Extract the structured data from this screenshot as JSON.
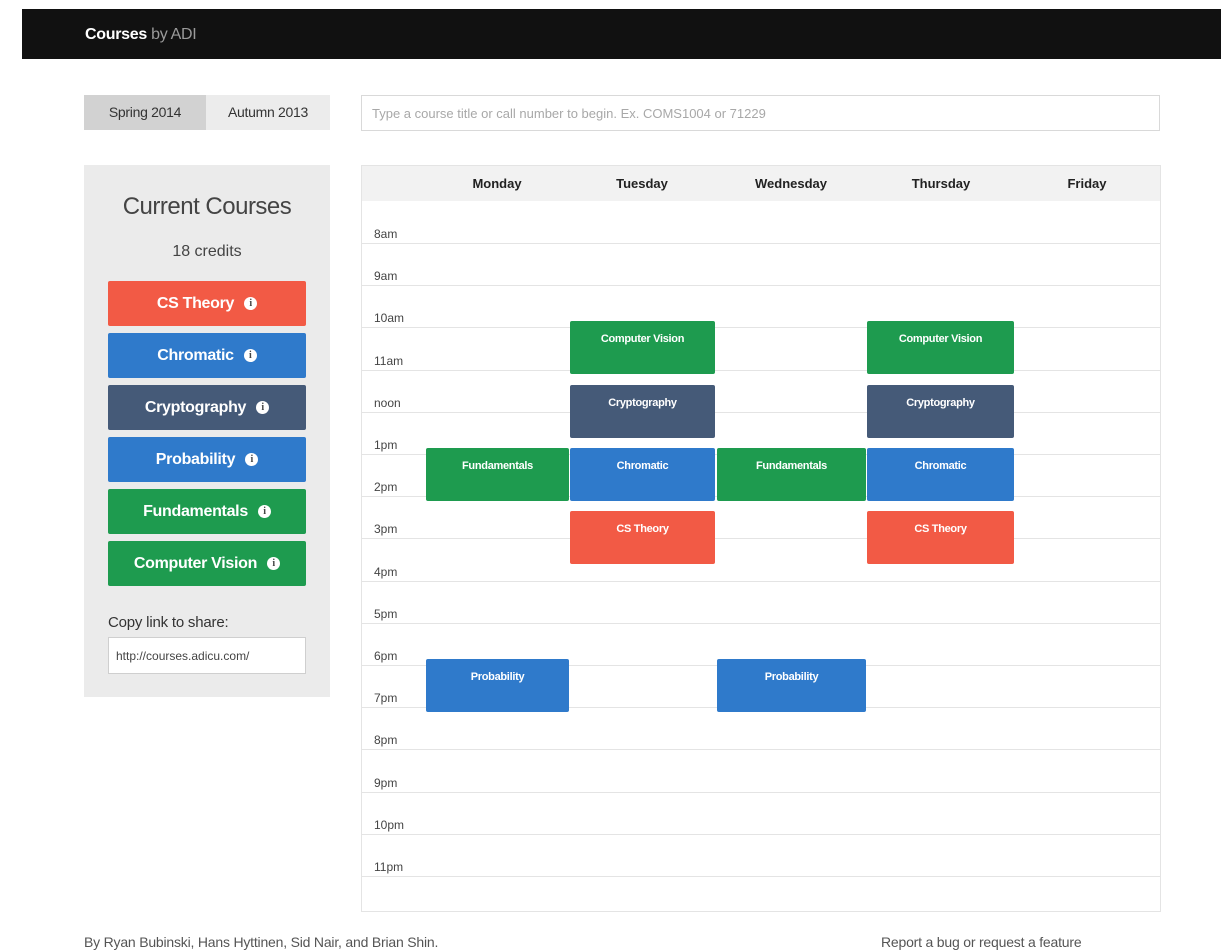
{
  "navbar": {
    "brand_name": "Courses",
    "brand_by": "by ADI"
  },
  "terms": [
    {
      "label": "Spring 2014",
      "active": true
    },
    {
      "label": "Autumn 2013",
      "active": false
    }
  ],
  "search": {
    "placeholder": "Type a course title or call number to begin. Ex. COMS1004 or 71229",
    "value": ""
  },
  "sidebar": {
    "title": "Current Courses",
    "credits": "18 credits",
    "courses": [
      {
        "label": "CS Theory",
        "color": "#f25a45"
      },
      {
        "label": "Chromatic",
        "color": "#2f7acb"
      },
      {
        "label": "Cryptography",
        "color": "#455a78"
      },
      {
        "label": "Probability",
        "color": "#2f7acb"
      },
      {
        "label": "Fundamentals",
        "color": "#1e9b4f"
      },
      {
        "label": "Computer Vision",
        "color": "#1e9b4f"
      }
    ],
    "share_label": "Copy link to share:",
    "share_value": "http://courses.adicu.com/"
  },
  "calendar": {
    "days": [
      "Monday",
      "Tuesday",
      "Wednesday",
      "Thursday",
      "Friday"
    ],
    "hours": [
      "8am",
      "9am",
      "10am",
      "11am",
      "noon",
      "1pm",
      "2pm",
      "3pm",
      "4pm",
      "5pm",
      "6pm",
      "7pm",
      "8pm",
      "9pm",
      "10pm",
      "11pm"
    ],
    "events": [
      {
        "label": "Computer Vision",
        "day": "Tuesday",
        "start": "11am",
        "color": "#1e9b4f"
      },
      {
        "label": "Computer Vision",
        "day": "Thursday",
        "start": "11am",
        "color": "#1e9b4f"
      },
      {
        "label": "Cryptography",
        "day": "Tuesday",
        "start": "12:30pm",
        "color": "#455a78"
      },
      {
        "label": "Cryptography",
        "day": "Thursday",
        "start": "12:30pm",
        "color": "#455a78"
      },
      {
        "label": "Fundamentals",
        "day": "Monday",
        "start": "2pm",
        "color": "#1e9b4f"
      },
      {
        "label": "Fundamentals",
        "day": "Wednesday",
        "start": "2pm",
        "color": "#1e9b4f"
      },
      {
        "label": "Chromatic",
        "day": "Tuesday",
        "start": "2pm",
        "color": "#2f7acb"
      },
      {
        "label": "Chromatic",
        "day": "Thursday",
        "start": "2pm",
        "color": "#2f7acb"
      },
      {
        "label": "CS Theory",
        "day": "Tuesday",
        "start": "3:30pm",
        "color": "#f25a45"
      },
      {
        "label": "CS Theory",
        "day": "Thursday",
        "start": "3:30pm",
        "color": "#f25a45"
      },
      {
        "label": "Probability",
        "day": "Monday",
        "start": "7pm",
        "color": "#2f7acb"
      },
      {
        "label": "Probability",
        "day": "Wednesday",
        "start": "7pm",
        "color": "#2f7acb"
      }
    ]
  },
  "footer": {
    "credits": "By Ryan Bubinski, Hans Hyttinen, Sid Nair, and Brian Shin.",
    "report_link": "Report a bug or request a feature"
  }
}
